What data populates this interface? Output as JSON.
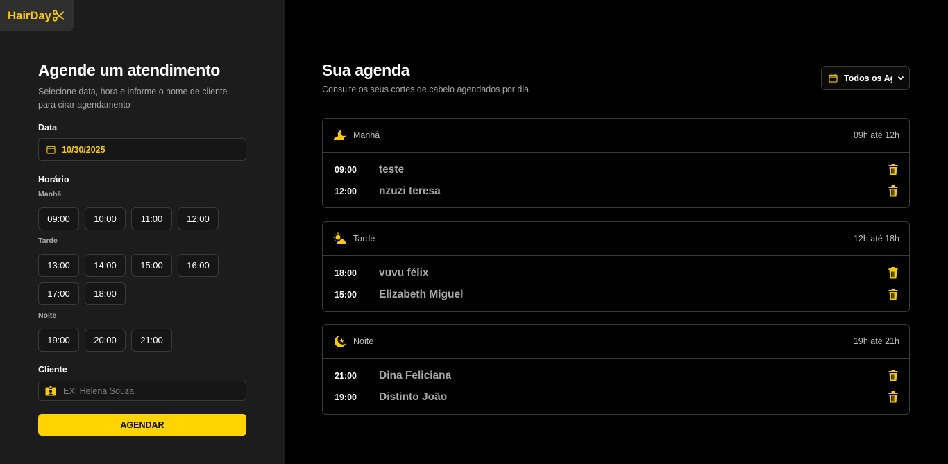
{
  "brand": {
    "name": "HairDay"
  },
  "booking": {
    "title": "Agende um atendimento",
    "subtitle": "Selecione data, hora e informe o nome de cliente para cirar agendamento",
    "date_label": "Data",
    "date_value": "10/30/2025",
    "time_label": "Horário",
    "periods": [
      {
        "label": "Manhã",
        "hours": [
          "09:00",
          "10:00",
          "11:00",
          "12:00"
        ]
      },
      {
        "label": "Tarde",
        "hours": [
          "13:00",
          "14:00",
          "15:00",
          "16:00",
          "17:00",
          "18:00"
        ]
      },
      {
        "label": "Noite",
        "hours": [
          "19:00",
          "20:00",
          "21:00"
        ]
      }
    ],
    "client_label": "Cliente",
    "client_placeholder": "EX: Helena Souza",
    "submit_label": "AGENDAR"
  },
  "agenda": {
    "title": "Sua agenda",
    "subtitle": "Consulte os seus cortes de cabelo agendados por dia",
    "filter_value": "Todos os Agendamentos",
    "periods": [
      {
        "name": "Manhã",
        "range": "09h até 12h",
        "icon": "sun-horizon-icon",
        "items": [
          {
            "time": "09:00",
            "name": "teste"
          },
          {
            "time": "12:00",
            "name": "nzuzi teresa"
          }
        ]
      },
      {
        "name": "Tarde",
        "range": "12h até 18h",
        "icon": "cloud-sun-icon",
        "items": [
          {
            "time": "18:00",
            "name": "vuvu félix"
          },
          {
            "time": "15:00",
            "name": "Elizabeth Miguel"
          }
        ]
      },
      {
        "name": "Noite",
        "range": "19h até 21h",
        "icon": "moon-stars-icon",
        "items": [
          {
            "time": "21:00",
            "name": "Dina Feliciana"
          },
          {
            "time": "19:00",
            "name": "Distinto João"
          }
        ]
      }
    ]
  },
  "colors": {
    "accent": "#ffd400",
    "sidebar_bg": "#1c1c1c",
    "page_bg": "#000000",
    "border": "#3a3a3a"
  }
}
